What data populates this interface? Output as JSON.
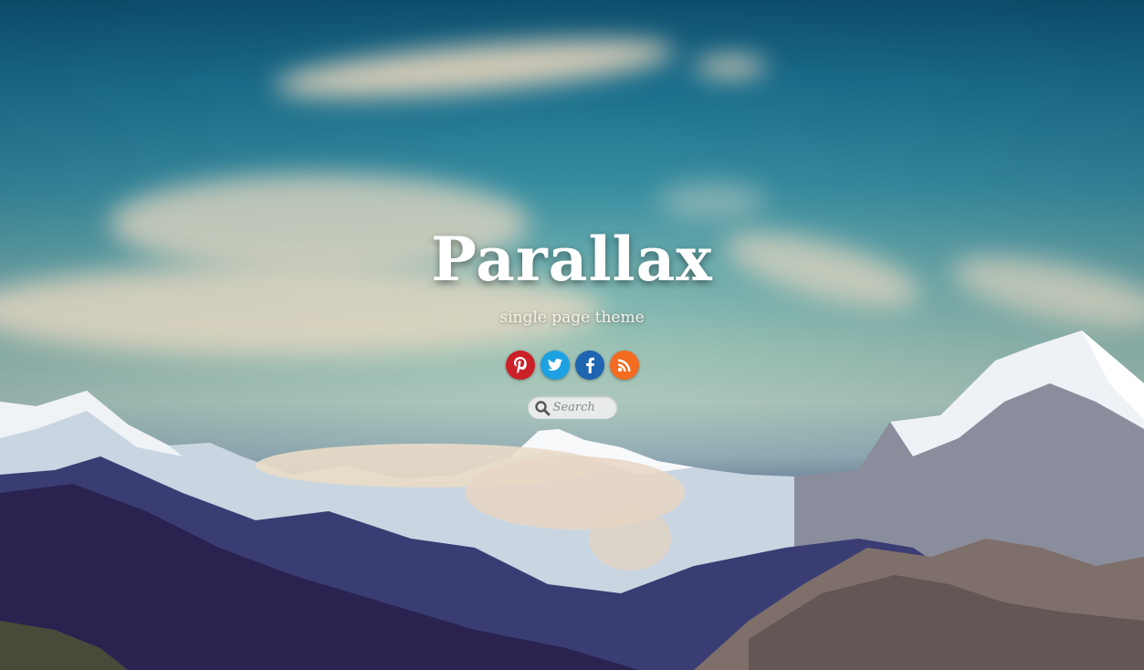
{
  "site": {
    "title": "Parallax",
    "tagline": "single page theme"
  },
  "social": [
    {
      "name": "pinterest",
      "glyph": "P",
      "color": "#cb2027",
      "icon": "pinterest-icon"
    },
    {
      "name": "twitter",
      "glyph": "t",
      "color": "#1da1e2",
      "icon": "twitter-icon"
    },
    {
      "name": "facebook",
      "glyph": "f",
      "color": "#1e64b0",
      "icon": "facebook-icon"
    },
    {
      "name": "rss",
      "glyph": "rss",
      "color": "#f26b21",
      "icon": "rss-icon"
    }
  ],
  "search": {
    "placeholder": "Search"
  }
}
